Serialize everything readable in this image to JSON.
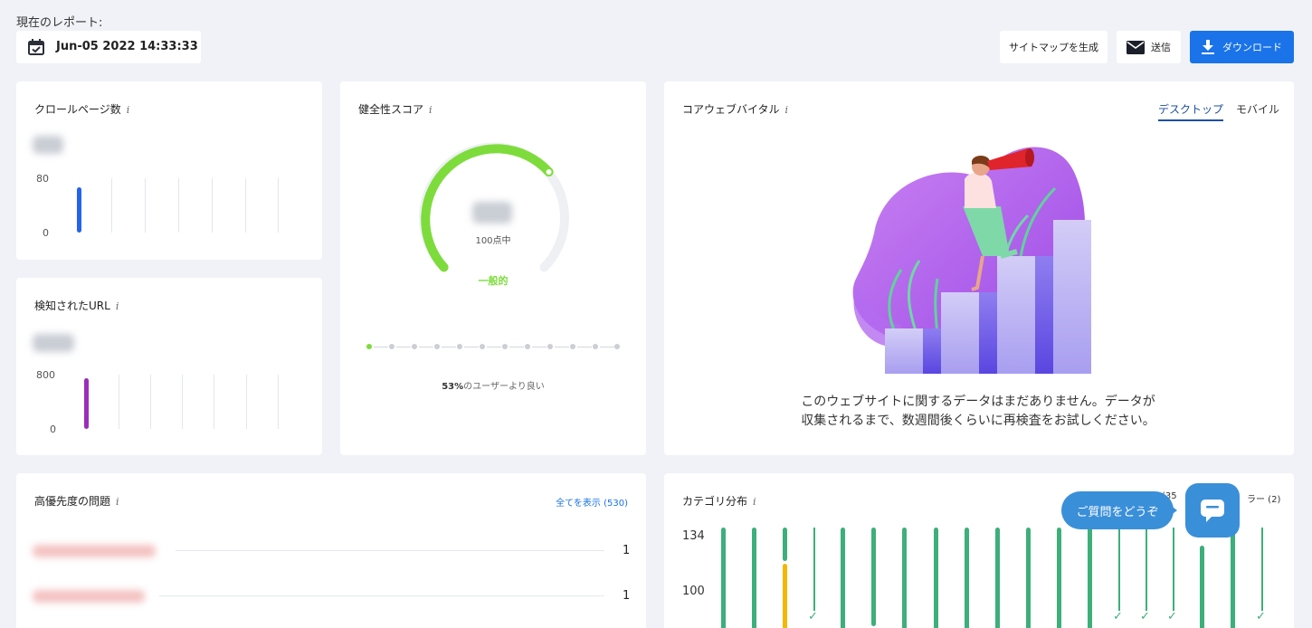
{
  "header": {
    "report_label": "現在のレポート:",
    "date": "Jun-05 2022 14:33:33",
    "sitemap_button": "サイトマップを生成",
    "send_button": "送信",
    "download_button": "ダウンロード"
  },
  "crawled": {
    "title": "クロールページ数",
    "y_top": "80",
    "y_bottom": "0"
  },
  "discovered": {
    "title": "検知されたURL",
    "y_top": "800",
    "y_bottom": "0"
  },
  "health": {
    "title": "健全性スコア",
    "out_of": "100点中",
    "status": "一般的",
    "percent": "53%",
    "better_than": "のユーザーより良い"
  },
  "cwv": {
    "title": "コアウェブバイタル",
    "tab_desktop": "デスクトップ",
    "tab_mobile": "モバイル",
    "message_line1": "このウェブサイトに関するデータはまだありません。データが",
    "message_line2": "収集されるまで、数週間後くらいに再検査をお試しください。"
  },
  "issues": {
    "title": "高優先度の問題",
    "view_all": "全てを表示 (530)",
    "rows": [
      {
        "count": "1"
      },
      {
        "count": "1"
      }
    ]
  },
  "category": {
    "title": "カテゴリ分布",
    "legend_a": "(35",
    "legend_b": "ラー (2)",
    "y_labels": [
      "134",
      "100"
    ]
  },
  "chat": {
    "bubble": "ご質問をどうぞ"
  },
  "colors": {
    "primary": "#1a73e8",
    "health_green": "#7ddc3c",
    "crawl_bar": "#2563eb",
    "url_bar": "#9b2db8",
    "category_green": "#3daf7a",
    "category_yellow": "#f5b800",
    "chat_blue": "#3a8fd9"
  }
}
